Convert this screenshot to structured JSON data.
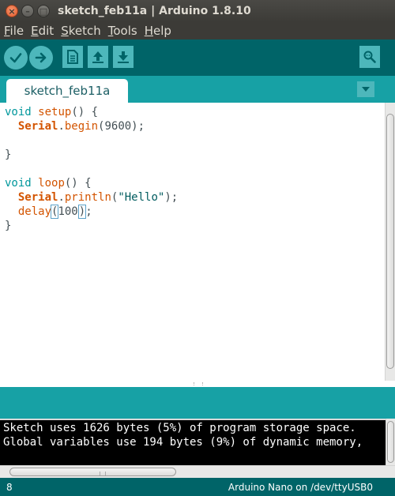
{
  "window": {
    "title": "sketch_feb11a | Arduino 1.8.10",
    "close_glyph": "×",
    "minimize_glyph": "–",
    "maximize_glyph": "□"
  },
  "menubar": {
    "items": [
      {
        "accel": "F",
        "rest": "ile"
      },
      {
        "accel": "E",
        "rest": "dit"
      },
      {
        "accel": "S",
        "rest": "ketch"
      },
      {
        "accel": "T",
        "rest": "ools"
      },
      {
        "accel": "H",
        "rest": "elp"
      }
    ]
  },
  "toolbar": {
    "buttons": [
      "verify-icon",
      "upload-icon",
      "new-icon",
      "open-icon",
      "save-icon",
      "serial-monitor-icon"
    ]
  },
  "tabs": [
    {
      "label": "sketch_feb11a",
      "active": true
    }
  ],
  "editor": {
    "tokens": {
      "void1": "void",
      "setup": "setup",
      "l1_rest": "() {",
      "serial1": "Serial",
      "dot1": ".",
      "begin": "begin",
      "l2_rest": "(9600);",
      "close1": "}",
      "void2": "void",
      "loop": "loop",
      "l5_rest": "() {",
      "serial2": "Serial",
      "dot2": ".",
      "println": "println",
      "paren_open": "(",
      "hello": "\"Hello\"",
      "l6_rest": ");",
      "delay": "delay",
      "delay_open": "(",
      "delay_num": "100",
      "delay_close": ")",
      "l7_rest": ";",
      "close2": "}"
    }
  },
  "console": {
    "lines": [
      "Sketch uses 1626 bytes (5%) of program storage space. ",
      "Global variables use 194 bytes (9%) of dynamic memory,"
    ]
  },
  "footer": {
    "line_number": "8",
    "board": "Arduino Nano on /dev/ttyUSB0"
  },
  "colors": {
    "toolbar_bg": "#006468",
    "tabstrip_bg": "#17a1a5",
    "button_bg": "#4db7bb",
    "keyword": "#00979c",
    "function": "#d35400"
  }
}
